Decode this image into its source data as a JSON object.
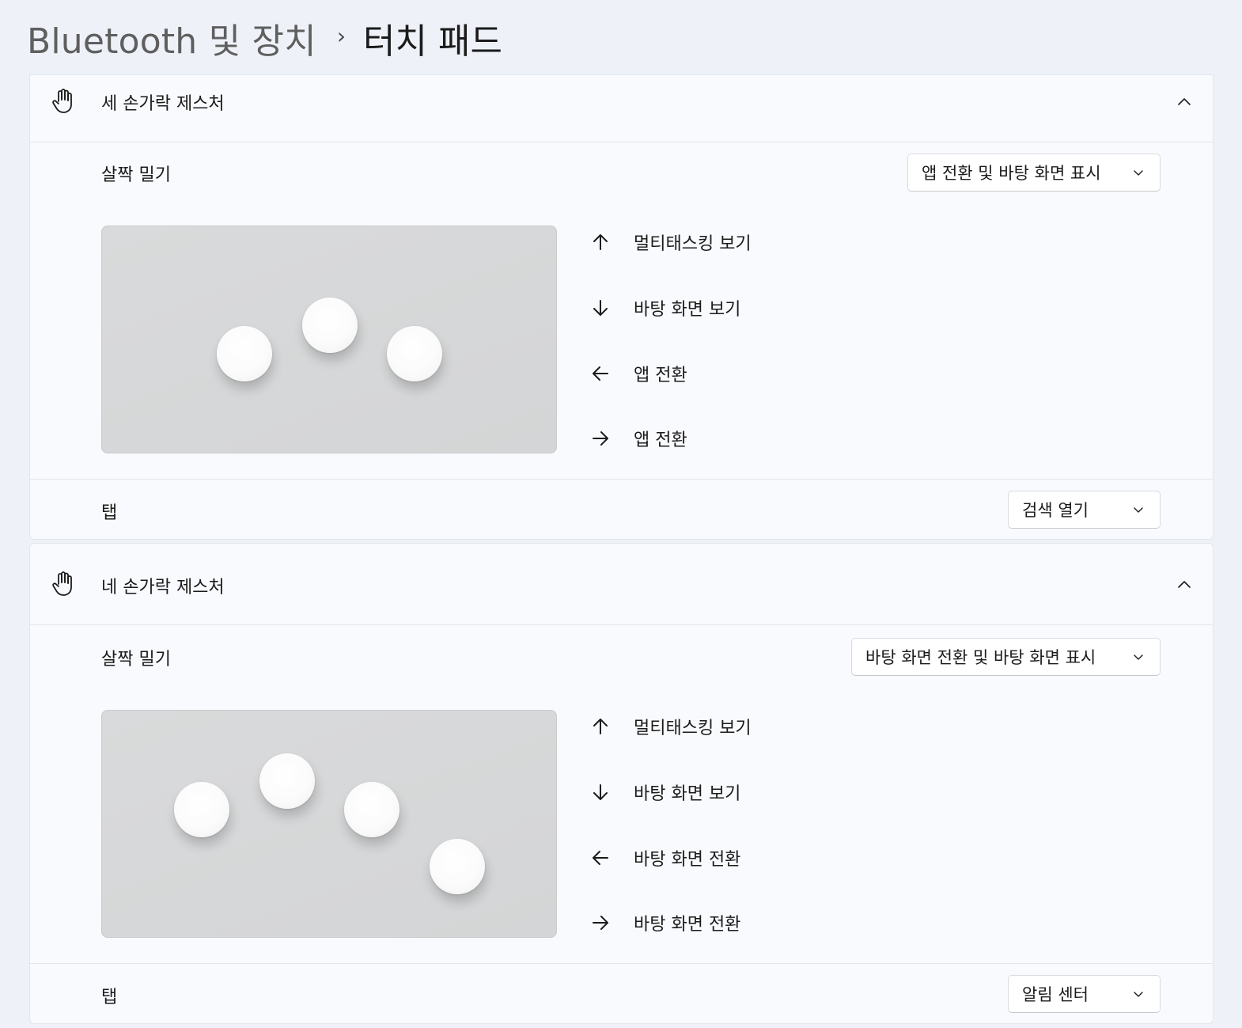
{
  "breadcrumb": {
    "parent": "Bluetooth 및 장치",
    "separator": "›",
    "current": "터치 패드"
  },
  "sections": [
    {
      "title": "세 손가락 제스처",
      "icon": "hand-icon",
      "swipe": {
        "label": "살짝 밀기",
        "value": "앱 전환 및 바탕 화면 표시",
        "fingers": 3,
        "gestures": [
          {
            "direction": "up",
            "icon": "arrow-up-icon",
            "label": "멀티태스킹 보기"
          },
          {
            "direction": "down",
            "icon": "arrow-down-icon",
            "label": "바탕 화면 보기"
          },
          {
            "direction": "left",
            "icon": "arrow-left-icon",
            "label": "앱 전환"
          },
          {
            "direction": "right",
            "icon": "arrow-right-icon",
            "label": "앱 전환"
          }
        ]
      },
      "tap": {
        "label": "탭",
        "value": "검색 열기"
      }
    },
    {
      "title": "네 손가락 제스처",
      "icon": "hand-icon",
      "swipe": {
        "label": "살짝 밀기",
        "value": "바탕 화면 전환 및 바탕 화면 표시",
        "fingers": 4,
        "gestures": [
          {
            "direction": "up",
            "icon": "arrow-up-icon",
            "label": "멀티태스킹 보기"
          },
          {
            "direction": "down",
            "icon": "arrow-down-icon",
            "label": "바탕 화면 보기"
          },
          {
            "direction": "left",
            "icon": "arrow-left-icon",
            "label": "바탕 화면 전환"
          },
          {
            "direction": "right",
            "icon": "arrow-right-icon",
            "label": "바탕 화면 전환"
          }
        ]
      },
      "tap": {
        "label": "탭",
        "value": "알림 센터"
      }
    }
  ]
}
